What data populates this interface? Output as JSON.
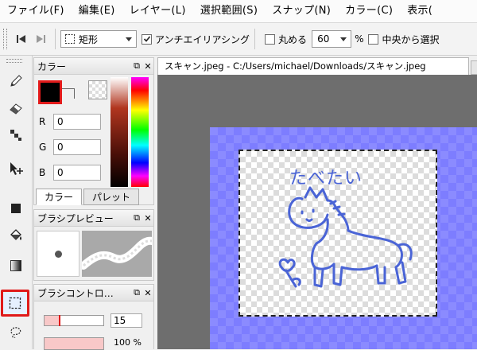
{
  "menu": {
    "items": [
      "ファイル(F)",
      "編集(E)",
      "レイヤー(L)",
      "選択範囲(S)",
      "スナップ(N)",
      "カラー(C)",
      "表示("
    ]
  },
  "toolbar": {
    "shape_label": "矩形",
    "antialias_label": "アンチエイリアシング",
    "antialias_checked": true,
    "round_label": "丸める",
    "round_value": "60",
    "round_unit": "%",
    "center_label": "中央から選択"
  },
  "panels": {
    "color": {
      "title": "カラー",
      "r_label": "R",
      "r_value": "0",
      "g_label": "G",
      "g_value": "0",
      "b_label": "B",
      "b_value": "0",
      "tab_color": "カラー",
      "tab_palette": "パレット"
    },
    "brush_preview": {
      "title": "ブラシプレビュー"
    },
    "brush_control": {
      "title": "ブラシコントロ…",
      "size_value": "15",
      "opacity_value": "100 %"
    }
  },
  "document": {
    "tab_title": "スキャン.jpeg - C:/Users/michael/Downloads/スキャン.jpeg",
    "drawing_text": "たべたい"
  },
  "colors": {
    "accent_red": "#e01a1a",
    "canvas_blue": "#8b8bff",
    "sketch_blue": "#4a64d6"
  }
}
